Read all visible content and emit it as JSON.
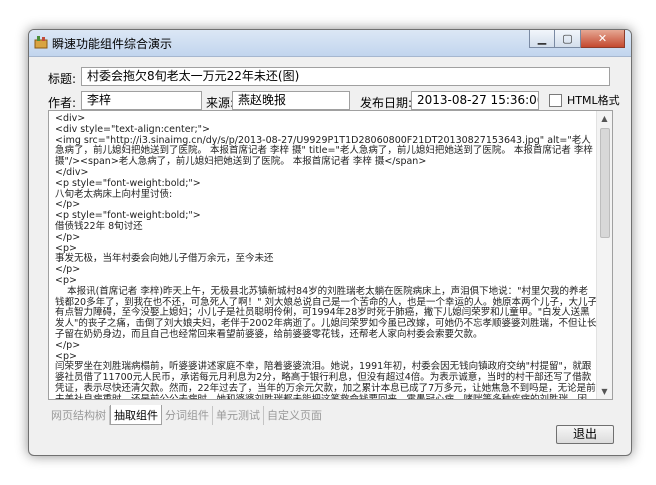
{
  "window": {
    "title": "瞬速功能组件综合演示",
    "controls": {
      "minimize": "▁",
      "maximize": "▢",
      "close": "✕"
    }
  },
  "form": {
    "title_label": "标题:",
    "title_value": "村委会拖欠8旬老太一万元22年未还(图)",
    "author_label": "作者:",
    "author_value": "李梓",
    "source_label": "来源:",
    "source_value": "燕赵晚报",
    "date_label": "发布日期:",
    "date_value": "2013-08-27 15:36:00",
    "html_format_label": "HTML格式",
    "html_format_checked": false
  },
  "content": {
    "html_text": "<div>\n<div style=\"text-align:center;\">\n<img src=\"http://i3.sinaimg.cn/dy/s/p/2013-08-27/U9929P1T1D28060800F21DT20130827153643.jpg\" alt=\"老人急病了，前儿媳妇把她送到了医院。 本报首席记者 李梓 摄\" title=\"老人急病了，前儿媳妇把她送到了医院。 本报首席记者 李梓 摄\"/><span>老人急病了，前儿媳妇把她送到了医院。 本报首席记者 李梓 摄</span>\n</div>\n<p style=\"font-weight:bold;\">\n八旬老太病床上向村里讨债:\n</p>\n<p style=\"font-weight:bold;\">\n借债钱22年 8旬讨还\n</p>\n<p>\n事发无极，当年村委会向她儿子借万余元，至今未还\n</p>\n<p>\n    本报讯(首席记者 李梓)昨天上午，无极县北苏镇新城村84岁的刘胜瑞老太躺在医院病床上，声泪俱下地说：\"村里欠我的养老钱都20多年了，到我在也不还，可急死人了啊！\" 刘大娘总说自己是一个苦命的人，也是一个幸运的人。她原本两个儿子，大儿子有点智力障碍，至今没娶上媳妇；小儿子是社员聪明伶俐，可1994年28岁时死于肺癌，撇下儿媳闫荣罗和儿童甲。\"白发人送黑发人\"的丧子之痛，击倒了刘大娘夫妇，老伴于2002年病逝了。儿媳闫荣罗如今虽已改嫁，可她仍不忘孝顺婆婆刘胜瑞，不但让长子留在奶奶身边，而且自己也经常回来看望前婆婆，给前婆婆零花钱，还帮老人家向村委会索要欠款。\n</p>\n<p>\n闫荣罗坐在刘胜瑞病榻前，听婆婆讲述家庭不幸，陪着婆婆流泪。她说，1991年初，村委会因无钱向镇政府交纳\"村提留\"，就跟婆社员借了11700元人民币，承诺每元月利息为2分，略高于银行利息，但没有超过4倍。为表示诚意，当时的村干部还写了借款凭证，表示尽快还清欠款。然而，22年过去了，当年的万余元欠款，加之累计本息已成了7万多元，让她焦急不到吗是，无论是前夫美社良病重时，还是前公公去病时，她和婆婆刘胜瑞都未能把这笔救命钱要回来。霍愚冠心病、哮喘等多种疾病的刘胜瑞，因"
  },
  "tabs": [
    {
      "label": "网页结构树",
      "active": false
    },
    {
      "label": "抽取组件",
      "active": true
    },
    {
      "label": "分词组件",
      "active": false
    },
    {
      "label": "单元测试",
      "active": false
    },
    {
      "label": "自定义页面",
      "active": false
    }
  ],
  "buttons": {
    "exit": "退出"
  },
  "scroll": {
    "up": "▲",
    "down": "▼"
  }
}
